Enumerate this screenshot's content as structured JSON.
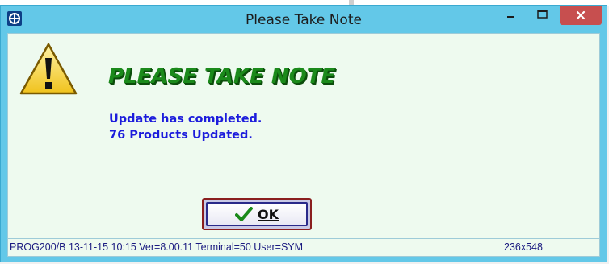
{
  "window": {
    "title": "Please Take Note",
    "app_icon": "app-logo-icon",
    "controls": {
      "minimize_icon": "minimize-icon",
      "maximize_icon": "maximize-icon",
      "close_icon": "close-icon",
      "close_color": "#c74f4f"
    },
    "frame_color": "#63c8e8"
  },
  "dialog": {
    "warning_icon": "warning-icon",
    "heading": "PLEASE TAKE NOTE",
    "heading_color": "#1b8a1b",
    "message_lines": [
      "Update has completed.",
      "76 Products Updated."
    ],
    "message_color": "#1c1cdc",
    "ok_button": {
      "label": "OK",
      "icon": "checkmark-icon"
    }
  },
  "statusbar": {
    "left": "PROG200/B  13-11-15 10:15  Ver=8.00.11 Terminal=50 User=SYM",
    "right": "236x548"
  }
}
